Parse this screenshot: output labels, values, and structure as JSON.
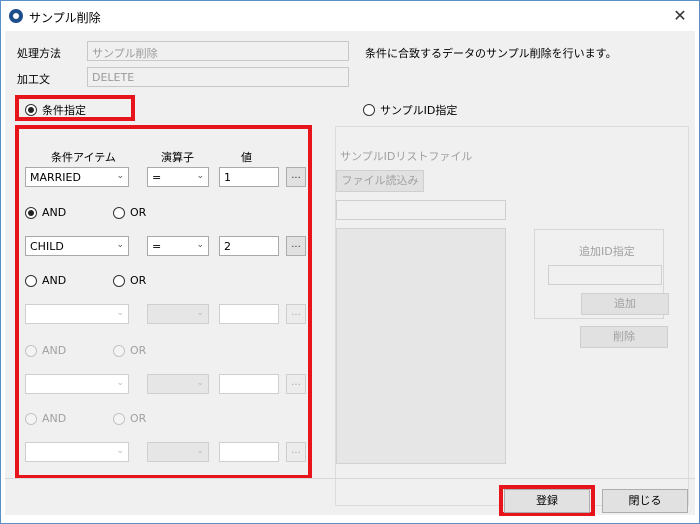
{
  "window": {
    "title": "サンプル削除",
    "close_glyph": "✕"
  },
  "form": {
    "process_method_label": "処理方法",
    "process_method_value": "サンプル削除",
    "processing_text_label": "加工文",
    "processing_text_value": "DELETE",
    "description": "条件に合致するデータのサンプル削除を行います。"
  },
  "mode": {
    "condition_label": "条件指定",
    "sample_id_label": "サンプルID指定"
  },
  "conditions": {
    "col_item": "条件アイテム",
    "col_operator": "演算子",
    "col_value": "値",
    "rows": [
      {
        "item": "MARRIED",
        "operator": "=",
        "value": "1"
      },
      {
        "item": "CHILD",
        "operator": "=",
        "value": "2"
      },
      {
        "item": "",
        "operator": "",
        "value": ""
      },
      {
        "item": "",
        "operator": "",
        "value": ""
      },
      {
        "item": "",
        "operator": "",
        "value": ""
      }
    ],
    "ellipsis": "...",
    "logic": [
      {
        "and": "AND",
        "or": "OR"
      },
      {
        "and": "AND",
        "or": "OR"
      },
      {
        "and": "AND",
        "or": "OR"
      },
      {
        "and": "AND",
        "or": "OR"
      }
    ]
  },
  "sample_id": {
    "list_file_label": "サンプルIDリストファイル",
    "load_file_button": "ファイル読込み",
    "add_id_label": "追加ID指定",
    "add_button": "追加",
    "delete_button": "削除"
  },
  "footer": {
    "register_button": "登録",
    "close_button": "閉じる"
  }
}
